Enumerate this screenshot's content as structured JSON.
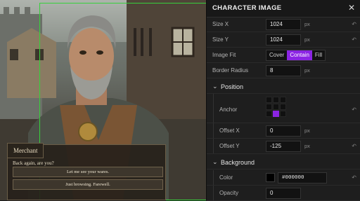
{
  "preview": {
    "speaker": "Merchant",
    "line": "Back again, are you?",
    "choices": [
      "Let me see your wares.",
      "Just browsing. Farewell."
    ]
  },
  "panel": {
    "title": "CHARACTER IMAGE",
    "close_icon": "close-icon",
    "size_x": {
      "label": "Size X",
      "value": "1024",
      "unit": "px"
    },
    "size_y": {
      "label": "Size Y",
      "value": "1024",
      "unit": "px"
    },
    "image_fit": {
      "label": "Image Fit",
      "options": [
        "Cover",
        "Contain",
        "Fill"
      ],
      "selected": "Contain"
    },
    "border_radius": {
      "label": "Border Radius",
      "value": "8",
      "unit": "px"
    },
    "position_section": "Position",
    "anchor": {
      "label": "Anchor",
      "selected": "bottom-center"
    },
    "offset_x": {
      "label": "Offset X",
      "value": "0",
      "unit": "px"
    },
    "offset_y": {
      "label": "Offset Y",
      "value": "-125",
      "unit": "px"
    },
    "background_section": "Background",
    "color": {
      "label": "Color",
      "value": "#000000",
      "swatch": "#000000"
    },
    "opacity": {
      "label": "Opacity",
      "value": "0"
    }
  },
  "colors": {
    "accent": "#8b24e3",
    "guide": "#37d13b"
  }
}
